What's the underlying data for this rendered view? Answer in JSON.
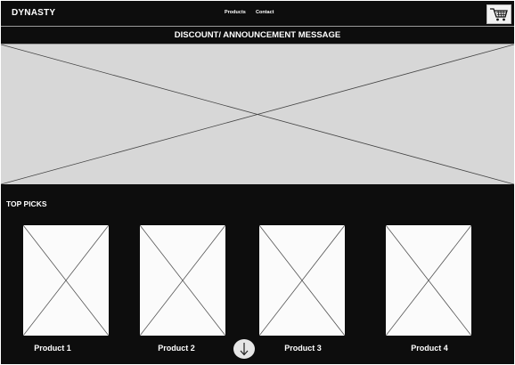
{
  "navbar": {
    "brand": "DYNASTY",
    "links": [
      "Products",
      "Contact"
    ],
    "cart_icon": "shopping-cart-icon"
  },
  "announcement": {
    "text": "DISCOUNT/ ANNOUNCEMENT MESSAGE"
  },
  "hero": {
    "image": "image-placeholder"
  },
  "top_picks": {
    "title": "TOP PICKS",
    "products": [
      {
        "name": "Product 1"
      },
      {
        "name": "Product 2"
      },
      {
        "name": "Product 3"
      },
      {
        "name": "Product 4"
      }
    ],
    "scroll_icon": "arrow-down-icon"
  },
  "colors": {
    "background": "#0d0d0d",
    "text": "#ffffff",
    "hero_placeholder": "#d7d7d7",
    "card_placeholder": "#fbfbfb"
  }
}
